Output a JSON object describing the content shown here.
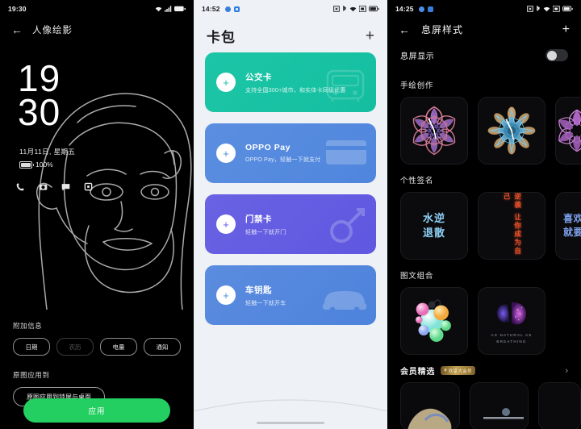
{
  "panel1": {
    "status": {
      "time": "19:30",
      "icons": [
        "wifi-icon",
        "signal-icon",
        "battery-icon"
      ]
    },
    "back_label": "←",
    "title": "人像绘影",
    "preview": {
      "hour": "19",
      "minute": "30",
      "date": "11月11日, 星期五",
      "battery": "100%",
      "shortcuts": [
        "phone-icon",
        "camera-icon",
        "message-icon",
        "screenshot-icon"
      ]
    },
    "extra_info": {
      "label": "附加信息",
      "chips": [
        {
          "label": "日期",
          "selected": true
        },
        {
          "label": "农历",
          "selected": false
        },
        {
          "label": "电量",
          "selected": true
        },
        {
          "label": "通知",
          "selected": true
        }
      ]
    },
    "apply_to": {
      "label": "原图应用到",
      "chip": "原图应用到锁屏与桌面"
    },
    "apply_button": "应用",
    "accent": "#24cf61"
  },
  "panel2": {
    "status": {
      "time": "14:52",
      "apps": [
        "app-dot-icon",
        "app-square-icon"
      ],
      "icons": [
        "nfc-icon",
        "bluetooth-icon",
        "wifi-icon",
        "signal-icon",
        "battery-icon"
      ]
    },
    "title": "卡包",
    "add_label": "+",
    "cards": [
      {
        "name": "公交卡",
        "desc": "支持全国300+城市，和实体卡同级优惠",
        "art": "bus-icon",
        "color": "#18c2a3"
      },
      {
        "name": "OPPO Pay",
        "desc": "OPPO Pay，轻触一下就支付",
        "art": "creditcard-icon",
        "color": "#5188de"
      },
      {
        "name": "门禁卡",
        "desc": "轻触一下就开门",
        "art": "key-icon",
        "color": "#6159e0"
      },
      {
        "name": "车钥匙",
        "desc": "轻触一下就开车",
        "art": "car-icon",
        "color": "#5086dd"
      }
    ]
  },
  "panel3": {
    "status": {
      "time": "14:25",
      "apps": [
        "app-dot-icon",
        "app-square-icon"
      ],
      "icons": [
        "nfc-icon",
        "bluetooth-icon",
        "wifi-icon",
        "signal-icon",
        "battery-icon"
      ]
    },
    "back_label": "←",
    "title": "息屏样式",
    "add_label": "+",
    "aod_toggle": {
      "label": "息屏显示",
      "on": false
    },
    "sections": [
      {
        "title": "手绘创作",
        "items": [
          {
            "kind": "kaleidoscope",
            "palette": [
              "#e2768f",
              "#8b6fd4",
              "#5a4aa8"
            ]
          },
          {
            "kind": "kaleidoscope",
            "palette": [
              "#6ec6e8",
              "#c9a06a",
              "#5fa8cf"
            ]
          },
          {
            "kind": "kaleidoscope",
            "palette": [
              "#c06fd8",
              "#8a5fc4",
              "#b86fd0"
            ]
          }
        ]
      },
      {
        "title": "个性签名",
        "items": [
          {
            "kind": "text-cn",
            "lines": [
              "水逆",
              "退散"
            ],
            "color": "#8fd2f7"
          },
          {
            "kind": "text-vertical",
            "text": "逆袭 让你成为自己",
            "color": "#e8502a"
          },
          {
            "kind": "text-cn-left",
            "lines": [
              "喜欢的",
              "就要做"
            ],
            "color": "#7ea2ef"
          }
        ]
      },
      {
        "title": "图文组合",
        "items": [
          {
            "kind": "bubbles",
            "caption": ""
          },
          {
            "kind": "brain",
            "caption": "AS NATURAL AS\nBREATHING"
          }
        ]
      }
    ],
    "member": {
      "title": "会员精选",
      "badge": "欢享大会员",
      "badge_mark": "¥",
      "chevron": "›"
    }
  }
}
